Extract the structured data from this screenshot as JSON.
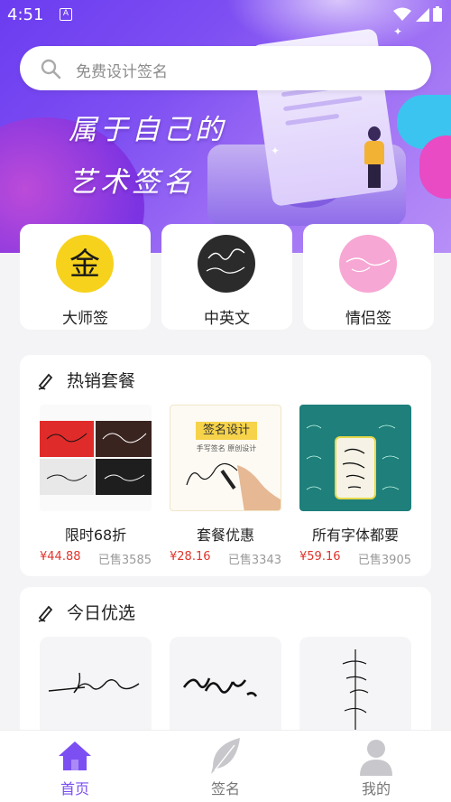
{
  "status_bar": {
    "time": "4:51",
    "app_indicator": "A"
  },
  "search": {
    "placeholder": "免费设计签名"
  },
  "hero": {
    "line1": "属于自己的",
    "line2": "艺术签名"
  },
  "categories": [
    {
      "label": "大师签",
      "icon": "gold-seal-icon"
    },
    {
      "label": "中英文",
      "icon": "bilingual-signature-icon"
    },
    {
      "label": "情侣签",
      "icon": "couple-signature-icon"
    }
  ],
  "hot_packages": {
    "title": "热销套餐",
    "items": [
      {
        "name": "限时68折",
        "price": "¥44.88",
        "sold": "已售3585"
      },
      {
        "name": "套餐优惠",
        "price": "¥28.16",
        "sold": "已售3343",
        "image_title": "签名设计",
        "image_tags": "手写签名  原创设计"
      },
      {
        "name": "所有字体都要",
        "price": "¥59.16",
        "sold": "已售3905"
      }
    ]
  },
  "today_picks": {
    "title": "今日优选"
  },
  "bottom_nav": [
    {
      "label": "首页",
      "active": true
    },
    {
      "label": "签名",
      "active": false
    },
    {
      "label": "我的",
      "active": false
    }
  ],
  "colors": {
    "accent": "#7b4ff2",
    "price": "#e0352b",
    "inactive": "#c8c8cc"
  }
}
